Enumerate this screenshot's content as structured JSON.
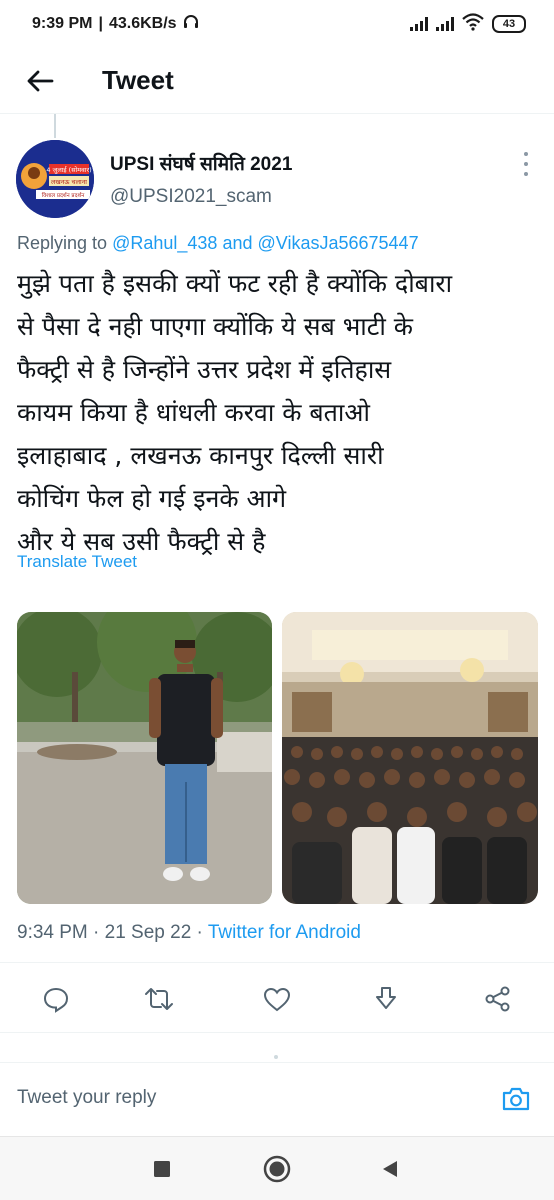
{
  "status_bar": {
    "time": "9:39 PM",
    "network_speed": "43.6KB/s",
    "battery": "43",
    "icons": [
      "headphones-icon",
      "signal-icon",
      "wifi-icon",
      "battery-icon"
    ]
  },
  "header": {
    "title": "Tweet",
    "back_icon": "arrow-left-icon"
  },
  "tweet": {
    "author_name": "UPSI संघर्ष समिति 2021",
    "author_handle": "@UPSI2021_scam",
    "avatar": {
      "lines": [
        "4 जुलाई (सोमवार)",
        "लखनऊ चलाना",
        "विशाल प्रदर्शन प्रदर्शन"
      ]
    },
    "replying_prefix": "Replying to",
    "mention_1": "@Rahul_438",
    "replying_and": "and",
    "mention_2": "@VikasJa56675447",
    "text": "मुझे पता है इसकी क्यों फट रही है क्योंकि दोबारा\nसे पैसा दे नही पाएगा क्योंकि ये सब भाटी के\nफैक्ट्री से है जिन्होंने उत्तर प्रदेश में इतिहास\nकायम किया है धांधली करवा के बताओ\nइलाहाबाद , लखनऊ कानपुर दिल्ली सारी\nकोचिंग फेल हो गई इनके आगे\nऔर ये सब उसी फैक्ट्री से है",
    "translate_label": "Translate Tweet",
    "photos": [
      {
        "description_icon": "photo-man-standing"
      },
      {
        "description_icon": "photo-crowd-hall"
      }
    ],
    "timestamp": "9:34 PM · 21 Sep 22 · ",
    "source": "Twitter for Android"
  },
  "actions": [
    {
      "name": "reply",
      "icon": "reply-icon"
    },
    {
      "name": "retweet",
      "icon": "retweet-icon"
    },
    {
      "name": "like",
      "icon": "heart-icon"
    },
    {
      "name": "bookmark",
      "icon": "download-icon"
    },
    {
      "name": "share",
      "icon": "share-icon"
    }
  ],
  "reply": {
    "placeholder": "Tweet your reply",
    "camera_icon": "camera-icon"
  },
  "nav": {
    "buttons": [
      "recents-icon",
      "home-icon",
      "back-icon"
    ]
  },
  "colors": {
    "accent": "#1d9bf0",
    "secondary_text": "#536471",
    "primary_text": "#0f1419"
  }
}
